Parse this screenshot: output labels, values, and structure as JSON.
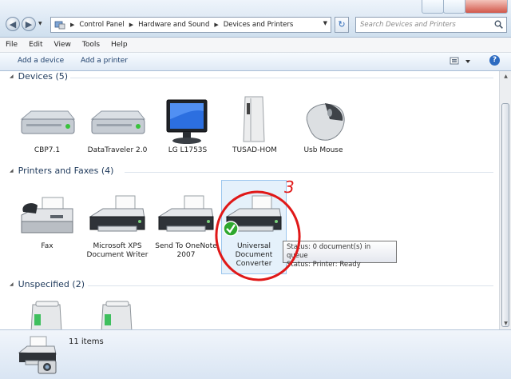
{
  "window": {
    "breadcrumb": [
      "Control Panel",
      "Hardware and Sound",
      "Devices and Printers"
    ],
    "search_placeholder": "Search Devices and Printers"
  },
  "menu": [
    "File",
    "Edit",
    "View",
    "Tools",
    "Help"
  ],
  "commands": {
    "add_device": "Add a device",
    "add_printer": "Add a printer"
  },
  "groups": {
    "devices": {
      "title": "Devices (5)",
      "items": [
        {
          "label": "CBP7.1",
          "icon": "drive-icon"
        },
        {
          "label": "DataTraveler 2.0",
          "icon": "drive-icon"
        },
        {
          "label": "LG L1753S",
          "icon": "monitor-icon"
        },
        {
          "label": "TUSAD-HOM",
          "icon": "computer-tower-icon"
        },
        {
          "label": "Usb Mouse",
          "icon": "mouse-icon"
        }
      ]
    },
    "printers": {
      "title": "Printers and Faxes (4)",
      "items": [
        {
          "label": "Fax",
          "icon": "fax-icon"
        },
        {
          "label": "Microsoft XPS Document Writer",
          "icon": "printer-icon"
        },
        {
          "label": "Send To OneNote 2007",
          "icon": "printer-icon"
        },
        {
          "label": "Universal Document Converter",
          "icon": "printer-default-icon",
          "selected": true
        }
      ]
    },
    "unspecified": {
      "title": "Unspecified (2)",
      "items": [
        {
          "label": "",
          "icon": "unspecified-device-icon"
        },
        {
          "label": "",
          "icon": "unspecified-device-icon"
        }
      ]
    }
  },
  "tooltip": {
    "line1": "Status: 0 document(s) in queue",
    "line2": "Status: Printer: Ready"
  },
  "annotation": {
    "number": "3",
    "color": "#e01818"
  },
  "status": {
    "item_count": "11 items"
  },
  "colors": {
    "accent": "#1e395b",
    "selection": "#e5f1fb",
    "default_check": "#2ea82e"
  }
}
